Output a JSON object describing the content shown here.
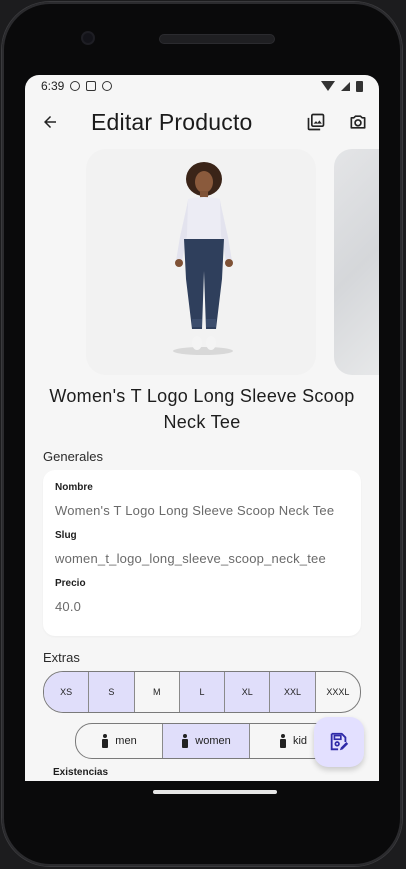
{
  "status_bar": {
    "time": "6:39"
  },
  "appbar": {
    "title": "Editar Producto"
  },
  "product": {
    "title": "Women's T Logo Long Sleeve Scoop Neck Tee"
  },
  "sections": {
    "general": "Generales",
    "extras": "Extras",
    "stock": "Existencias"
  },
  "form": {
    "name_label": "Nombre",
    "name_value": "Women's T Logo Long Sleeve Scoop Neck Tee",
    "slug_label": "Slug",
    "slug_value": "women_t_logo_long_sleeve_scoop_neck_tee",
    "price_label": "Precio",
    "price_value": "40.0"
  },
  "sizes": [
    {
      "label": "XS",
      "selected": true
    },
    {
      "label": "S",
      "selected": true
    },
    {
      "label": "M",
      "selected": false
    },
    {
      "label": "L",
      "selected": true
    },
    {
      "label": "XL",
      "selected": true
    },
    {
      "label": "XXL",
      "selected": true
    },
    {
      "label": "XXXL",
      "selected": false
    }
  ],
  "genders": [
    {
      "label": "men",
      "selected": false
    },
    {
      "label": "women",
      "selected": true
    },
    {
      "label": "kid",
      "selected": false
    }
  ],
  "colors": {
    "accent": "#e0defa",
    "fab": "#e3e0ff",
    "fab_icon": "#2f2aa8"
  }
}
